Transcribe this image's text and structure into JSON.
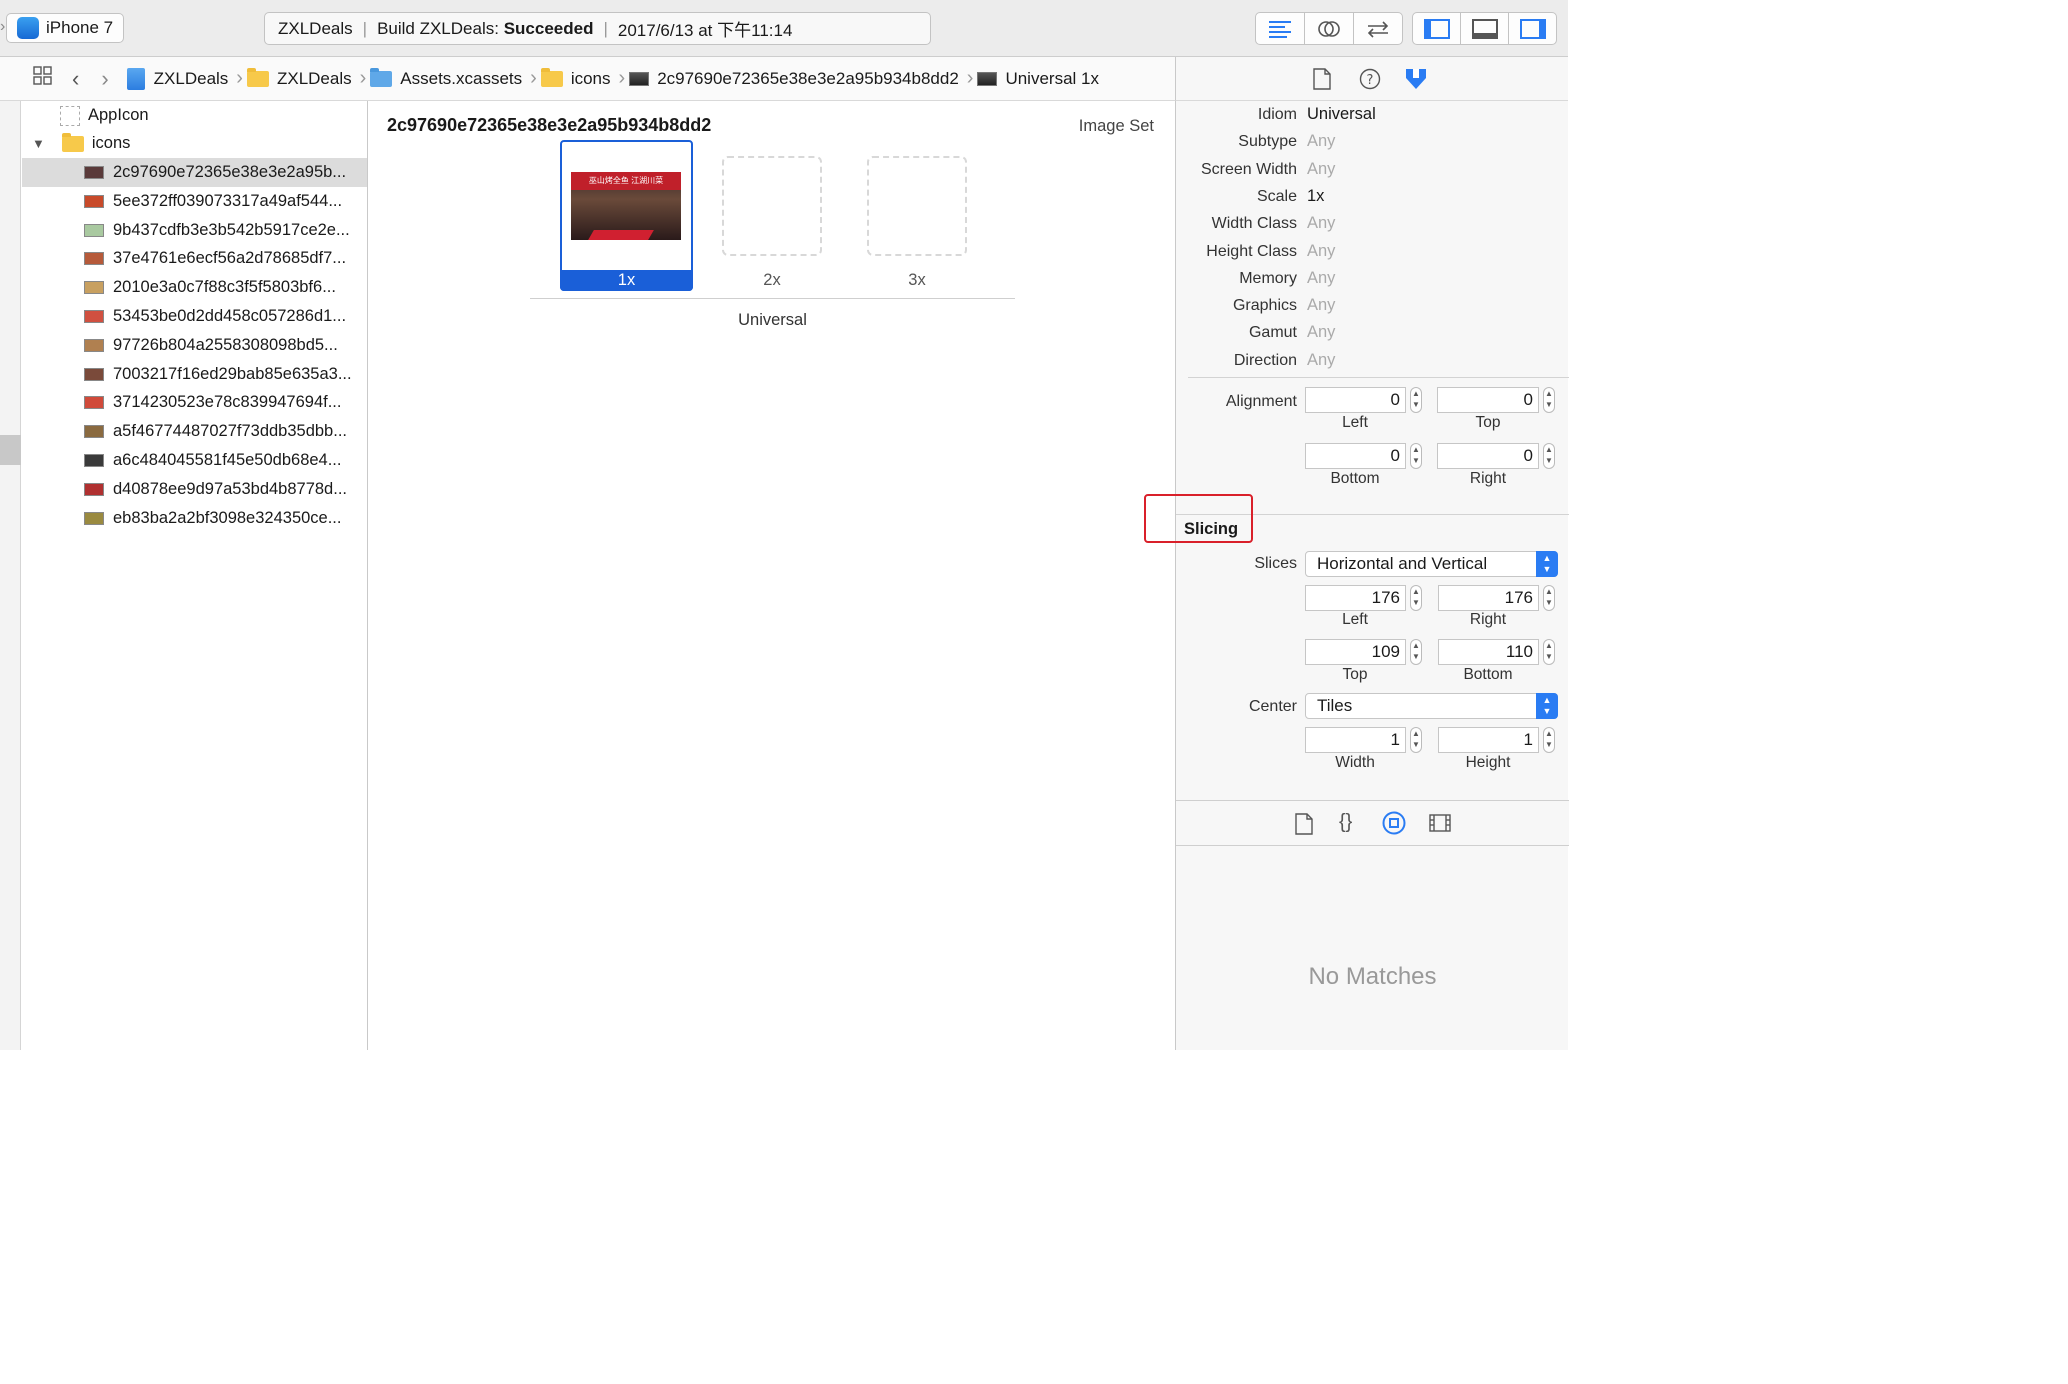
{
  "toolbar": {
    "scheme_device": "iPhone 7",
    "status_project": "ZXLDeals",
    "status_build_prefix": "Build ZXLDeals:",
    "status_build_result": "Succeeded",
    "status_timestamp": "2017/6/13 at 下午11:14"
  },
  "jumpbar": {
    "crumbs": [
      "ZXLDeals",
      "ZXLDeals",
      "Assets.xcassets",
      "icons",
      "2c97690e72365e38e3e2a95b934b8dd2",
      "Universal 1x"
    ]
  },
  "navigator": {
    "appicon_label": "AppIcon",
    "folder_label": "icons",
    "items": [
      {
        "label": "2c97690e72365e38e3e2a95b...",
        "selected": true,
        "color": "#5a3a3a"
      },
      {
        "label": "5ee372ff039073317a49af544...",
        "color": "#c84a2a"
      },
      {
        "label": "9b437cdfb3e3b542b5917ce2e...",
        "color": "#a9c9a0"
      },
      {
        "label": "37e4761e6ecf56a2d78685df7...",
        "color": "#b65a3a"
      },
      {
        "label": "2010e3a0c7f88c3f5f5803bf6...",
        "color": "#c8a060"
      },
      {
        "label": "53453be0d2dd458c057286d1...",
        "color": "#d05040"
      },
      {
        "label": "97726b804a2558308098bd5...",
        "color": "#b08050"
      },
      {
        "label": "7003217f16ed29bab85e635a3...",
        "color": "#7a4a3a"
      },
      {
        "label": "3714230523e78c839947694f...",
        "color": "#d04a3a"
      },
      {
        "label": "a5f46774487027f73ddb35dbb...",
        "color": "#8a6a40"
      },
      {
        "label": "a6c484045581f45e50db68e4...",
        "color": "#3a3a3a"
      },
      {
        "label": "d40878ee9d97a53bd4b8778d...",
        "color": "#b03030"
      },
      {
        "label": "eb83ba2a2bf3098e324350ce...",
        "color": "#9a8a40"
      }
    ]
  },
  "editor": {
    "title": "2c97690e72365e38e3e2a95b934b8dd2",
    "set_type": "Image Set",
    "slots": [
      "1x",
      "2x",
      "3x"
    ],
    "group_label": "Universal",
    "image_text": "巫山烤全鱼 江湖川菜"
  },
  "inspector": {
    "attributes": [
      {
        "label": "Idiom",
        "value": "Universal",
        "dim": false
      },
      {
        "label": "Subtype",
        "value": "Any",
        "dim": true
      },
      {
        "label": "Screen Width",
        "value": "Any",
        "dim": true
      },
      {
        "label": "Scale",
        "value": "1x",
        "dim": false
      },
      {
        "label": "Width Class",
        "value": "Any",
        "dim": true
      },
      {
        "label": "Height Class",
        "value": "Any",
        "dim": true
      },
      {
        "label": "Memory",
        "value": "Any",
        "dim": true
      },
      {
        "label": "Graphics",
        "value": "Any",
        "dim": true
      },
      {
        "label": "Gamut",
        "value": "Any",
        "dim": true
      },
      {
        "label": "Direction",
        "value": "Any",
        "dim": true
      }
    ],
    "alignment": {
      "label": "Alignment",
      "left": "0",
      "left_label": "Left",
      "top": "0",
      "top_label": "Top",
      "bottom": "0",
      "bottom_label": "Bottom",
      "right": "0",
      "right_label": "Right"
    },
    "slicing": {
      "header": "Slicing",
      "slices_label": "Slices",
      "slices_value": "Horizontal and Vertical",
      "left": "176",
      "left_label": "Left",
      "right": "176",
      "right_label": "Right",
      "top": "109",
      "top_label": "Top",
      "bottom": "110",
      "bottom_label": "Bottom",
      "center_label": "Center",
      "center_value": "Tiles",
      "width": "1",
      "width_label": "Width",
      "height": "1",
      "height_label": "Height"
    },
    "library_empty": "No Matches"
  },
  "colors": {
    "accent": "#2a7cf3",
    "selection": "#1a5fd8",
    "highlight_box": "#d9202a"
  }
}
